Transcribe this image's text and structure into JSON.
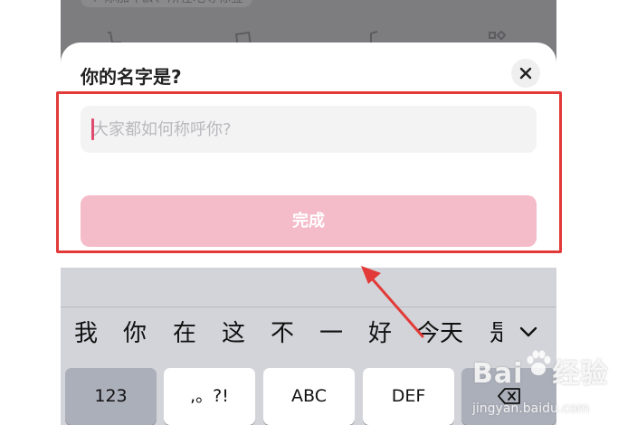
{
  "background_app": {
    "hint_text": "+ 添加年龄、所在地等标签"
  },
  "sheet": {
    "title": "你的名字是?",
    "name_input": {
      "placeholder": "大家都如何称呼你?",
      "value": ""
    },
    "done_label": "完成"
  },
  "keyboard": {
    "candidates": [
      "我",
      "你",
      "在",
      "这",
      "不",
      "一",
      "好",
      "今天",
      "是"
    ],
    "keys": [
      "123",
      ",。?!",
      "ABC",
      "DEF"
    ]
  },
  "watermark": {
    "url": "jingyan.baidu.com"
  },
  "colors": {
    "done_button": "#f4bcc8",
    "caret": "#e04a6c",
    "annotation_red": "#e23a38",
    "overlay_gray": "#7d7d80"
  },
  "icons": [
    "cart-icon",
    "folder-icon",
    "music-icon",
    "grid-icon",
    "close-icon",
    "chevron-down-icon",
    "delete-icon",
    "annotation-arrow"
  ]
}
